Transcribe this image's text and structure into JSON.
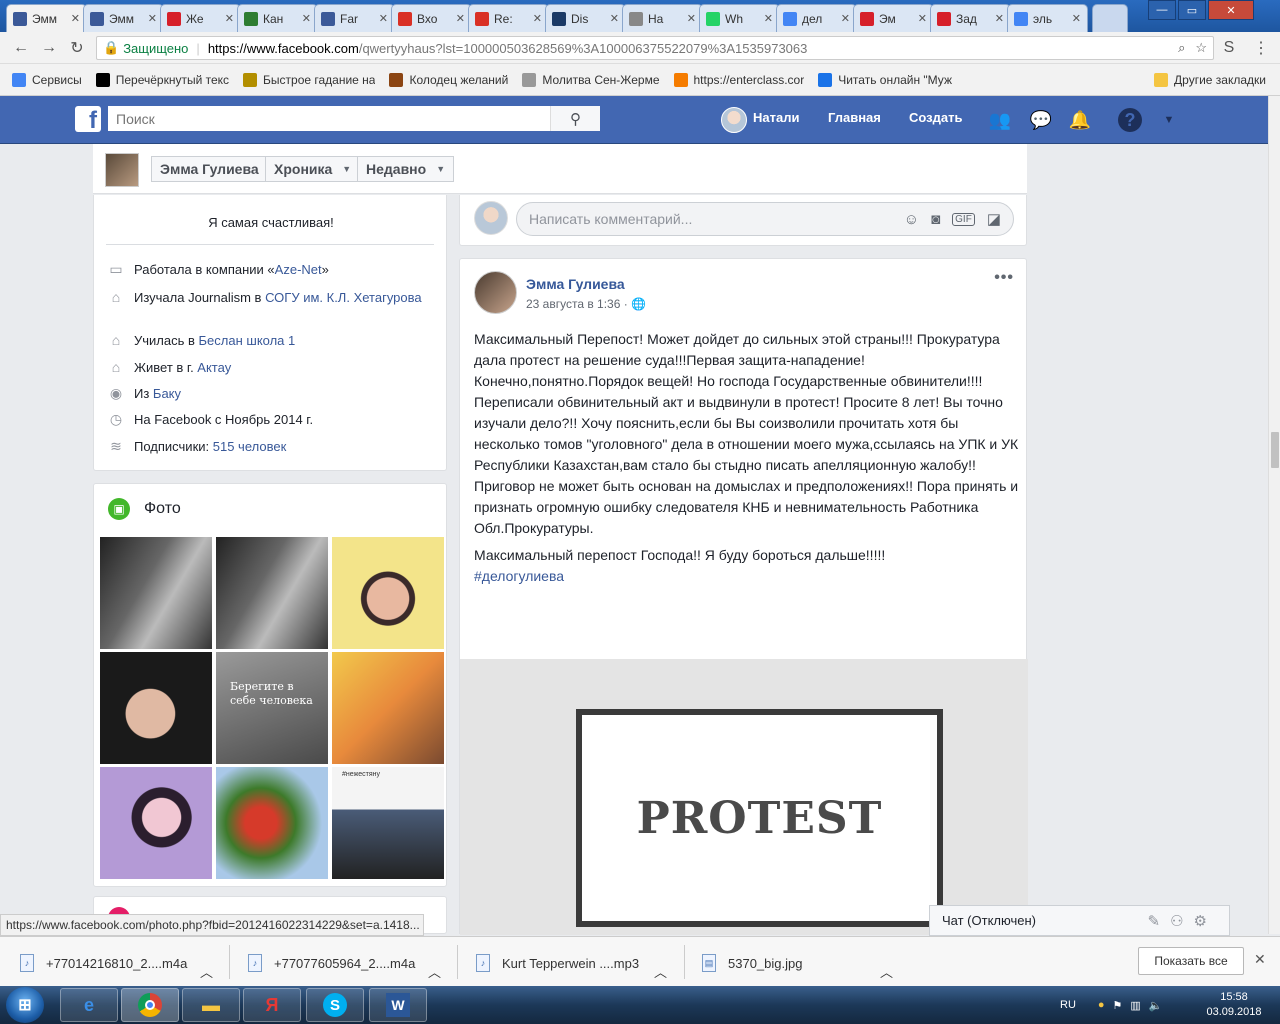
{
  "browser": {
    "tabs": [
      {
        "label": "Эмм",
        "icon": "facebook-icon",
        "color": "#3b5998",
        "active": true
      },
      {
        "label": "Эмм",
        "icon": "facebook-icon",
        "color": "#3b5998"
      },
      {
        "label": "Же",
        "icon": "n-icon",
        "color": "#d6202a"
      },
      {
        "label": "Кан",
        "icon": "calendar-icon",
        "color": "#2e7d32"
      },
      {
        "label": "Far",
        "icon": "facebook-icon",
        "color": "#3b5998"
      },
      {
        "label": "Вхо",
        "icon": "gmail-icon",
        "color": "#d93025"
      },
      {
        "label": "Re:",
        "icon": "gmail-icon",
        "color": "#d93025"
      },
      {
        "label": "Dis",
        "icon": "d-icon",
        "color": "#1b3a66"
      },
      {
        "label": "На",
        "icon": "page-icon",
        "color": "#888888"
      },
      {
        "label": "Wh",
        "icon": "whatsapp-icon",
        "color": "#25d366"
      },
      {
        "label": "дел",
        "icon": "google-icon",
        "color": "#4285f4"
      },
      {
        "label": "Эм",
        "icon": "n-icon",
        "color": "#d6202a"
      },
      {
        "label": "Зад",
        "icon": "n-icon",
        "color": "#d6202a"
      },
      {
        "label": "эль",
        "icon": "google-icon",
        "color": "#4285f4"
      }
    ],
    "url": {
      "secure_label": "Защищено",
      "scheme_host": "https://www.facebook.com",
      "path": "/qwertyyhaus?lst=100000503628569%3A100006375522079%3A1535973063"
    },
    "bookmarks": [
      {
        "label": "Сервисы",
        "icon": "apps-icon",
        "color": "#4285f4"
      },
      {
        "label": "Перечёркнутый текс",
        "icon": "sx-icon",
        "color": "#000000"
      },
      {
        "label": "Быстрое гадание на",
        "icon": "cards-icon",
        "color": "#b38f00"
      },
      {
        "label": "Колодец желаний",
        "icon": "well-icon",
        "color": "#8b4513"
      },
      {
        "label": "Молитва Сен-Жерме",
        "icon": "circle-icon",
        "color": "#999999"
      },
      {
        "label": "https://enterclass.cor",
        "icon": "e-icon",
        "color": "#f57c00"
      },
      {
        "label": "Читать онлайн \"Муж",
        "icon": "m-icon",
        "color": "#1a73e8"
      }
    ],
    "other_bookmarks": "Другие закладки"
  },
  "facebook": {
    "search_placeholder": "Поиск",
    "user_name": "Натали",
    "nav_home": "Главная",
    "nav_create": "Создать"
  },
  "timeline_header": {
    "name": "Эмма Гулиева",
    "chronicle": "Хроника",
    "recent": "Недавно"
  },
  "intro": {
    "bio": "Я самая счастливая!",
    "rows": [
      {
        "icon": "briefcase-icon",
        "prefix": "Работала в компании «",
        "link": "Aze-Net",
        "suffix": "»"
      },
      {
        "icon": "graduation-cap-icon",
        "prefix": "Изучала Journalism в ",
        "link": "СОГУ им. К.Л. Хетагурова",
        "suffix": ""
      },
      {
        "icon": "graduation-cap-icon",
        "prefix": "Училась в ",
        "link": "Беслан школа 1",
        "suffix": ""
      },
      {
        "icon": "home-icon",
        "prefix": "Живет в г. ",
        "link": "Актау",
        "suffix": ""
      },
      {
        "icon": "location-icon",
        "prefix": "Из ",
        "link": "Баку",
        "suffix": ""
      },
      {
        "icon": "clock-icon",
        "prefix": "На Facebook с Ноябрь 2014 г.",
        "link": "",
        "suffix": ""
      },
      {
        "icon": "rss-icon",
        "prefix": "Подписчики: ",
        "link": "515 человек",
        "suffix": ""
      }
    ]
  },
  "photos": {
    "title": "Фото",
    "tile8_caption": "Берегите в себе человека",
    "tile9_caption": "#нежестяну"
  },
  "comment": {
    "placeholder": "Написать комментарий..."
  },
  "post": {
    "author": "Эмма Гулиева",
    "date": "23 августа в 1:36",
    "paragraph1": "Максимальный Перепост! Может дойдет до сильных этой страны!!! Прокуратура дала протест на решение суда!!!Первая защита-нападение! Конечно,понятно.Порядок вещей! Но господа Государственные обвинители!!!! Переписали обвинительный акт и выдвинули в протест! Просите 8 лет! Вы точно изучали дело?!! Хочу пояснить,если бы Вы соизволили прочитать хотя бы несколько томов \"уголовного\" дела в отношении моего мужа,ссылаясь на УПК и УК Республики Казахстан,вам стало бы стыдно писать апелляционную жалобу!! Приговор не может быть основан на домыслах и предположениях!! Пора принять и признать огромную ошибку следователя КНБ и невнимательность Работника Обл.Прокуратуры.",
    "paragraph2": "Максимальный перепост Господа!! Я буду бороться дальше!!!!!",
    "hashtag": "#делогулиева",
    "image_word": "PROTEST"
  },
  "status_url": "https://www.facebook.com/photo.php?fbid=2012416022314229&set=a.1418...",
  "chat": {
    "label": "Чат (Отключен)"
  },
  "downloads": {
    "items": [
      {
        "name": "+77014216810_2....m4a"
      },
      {
        "name": "+77077605964_2....m4a"
      },
      {
        "name": "Kurt Tepperwein ....mp3"
      },
      {
        "name": "5370_big.jpg"
      }
    ],
    "show_all": "Показать все"
  },
  "taskbar": {
    "lang": "RU",
    "time": "15:58",
    "date": "03.09.2018"
  }
}
